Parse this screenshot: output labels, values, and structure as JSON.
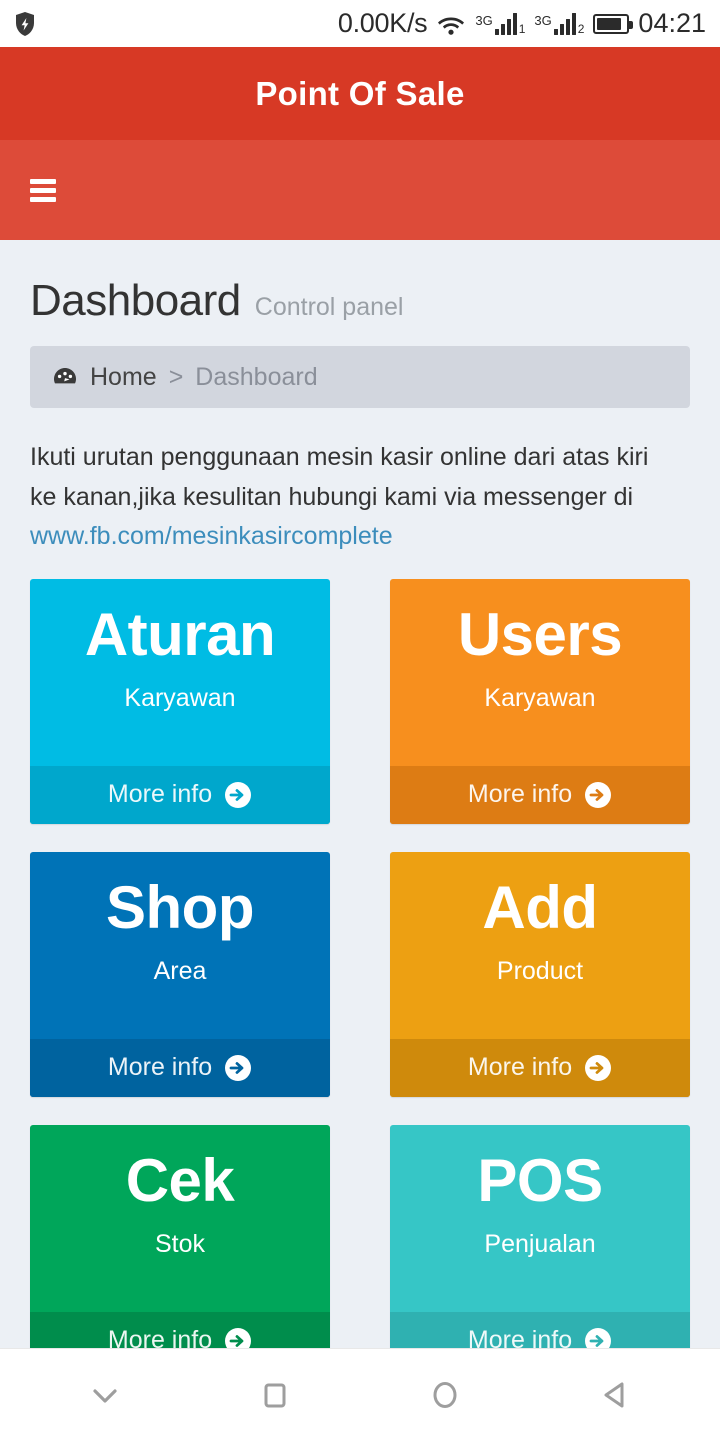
{
  "statusbar": {
    "shield_icon": "shield-icon",
    "network_speed": "0.00K/s",
    "wifi_icon": "wifi-icon",
    "sim1": {
      "network": "3G",
      "index": "1"
    },
    "sim2": {
      "network": "3G",
      "index": "2"
    },
    "battery_icon": "battery-icon",
    "battery_level_pct": 85,
    "clock": "04:21"
  },
  "header": {
    "app_title": "Point Of Sale",
    "bar_color": "#d73925",
    "navbar_color": "#dd4b39",
    "menu_icon": "hamburger-menu-icon"
  },
  "page": {
    "title": "Dashboard",
    "subtitle": "Control panel",
    "breadcrumb": {
      "icon": "tachometer-icon",
      "home_label": "Home",
      "separator": ">",
      "current_label": "Dashboard"
    },
    "intro_text": "Ikuti urutan penggunaan mesin kasir online dari atas kiri ke kanan,jika kesulitan hubungi kami via messenger di ",
    "intro_link": "www.fb.com/mesinkasircomplete",
    "link_color": "#3c8dbc",
    "background": "#ecf0f5"
  },
  "cards": [
    {
      "title": "Aturan",
      "subtitle": "Karyawan",
      "footer_label": "More info",
      "footer_icon": "arrow-circle-right-icon",
      "color": "#00bce4",
      "footer_color": "#00a7cc"
    },
    {
      "title": "Users",
      "subtitle": "Karyawan",
      "footer_label": "More info",
      "footer_icon": "arrow-circle-right-icon",
      "color": "#f78f1e",
      "footer_color": "#dd7c14"
    },
    {
      "title": "Shop",
      "subtitle": "Area",
      "footer_label": "More info",
      "footer_icon": "arrow-circle-right-icon",
      "color": "#0073b7",
      "footer_color": "#00639f"
    },
    {
      "title": "Add",
      "subtitle": "Product",
      "footer_label": "More info",
      "footer_icon": "arrow-circle-right-icon",
      "color": "#eda012",
      "footer_color": "#cf8a0c"
    },
    {
      "title": "Cek",
      "subtitle": "Stok",
      "footer_label": "More info",
      "footer_icon": "arrow-circle-right-icon",
      "color": "#00a65a",
      "footer_color": "#008d4c"
    },
    {
      "title": "POS",
      "subtitle": "Penjualan",
      "footer_label": "More info",
      "footer_icon": "arrow-circle-right-icon",
      "color": "#36c6c6",
      "footer_color": "#2fb1b1"
    }
  ],
  "sysnav": [
    {
      "name": "hide-keyboard-icon",
      "label": "Hide"
    },
    {
      "name": "recents-icon",
      "label": "Recents"
    },
    {
      "name": "home-icon",
      "label": "Home"
    },
    {
      "name": "back-icon",
      "label": "Back"
    }
  ]
}
